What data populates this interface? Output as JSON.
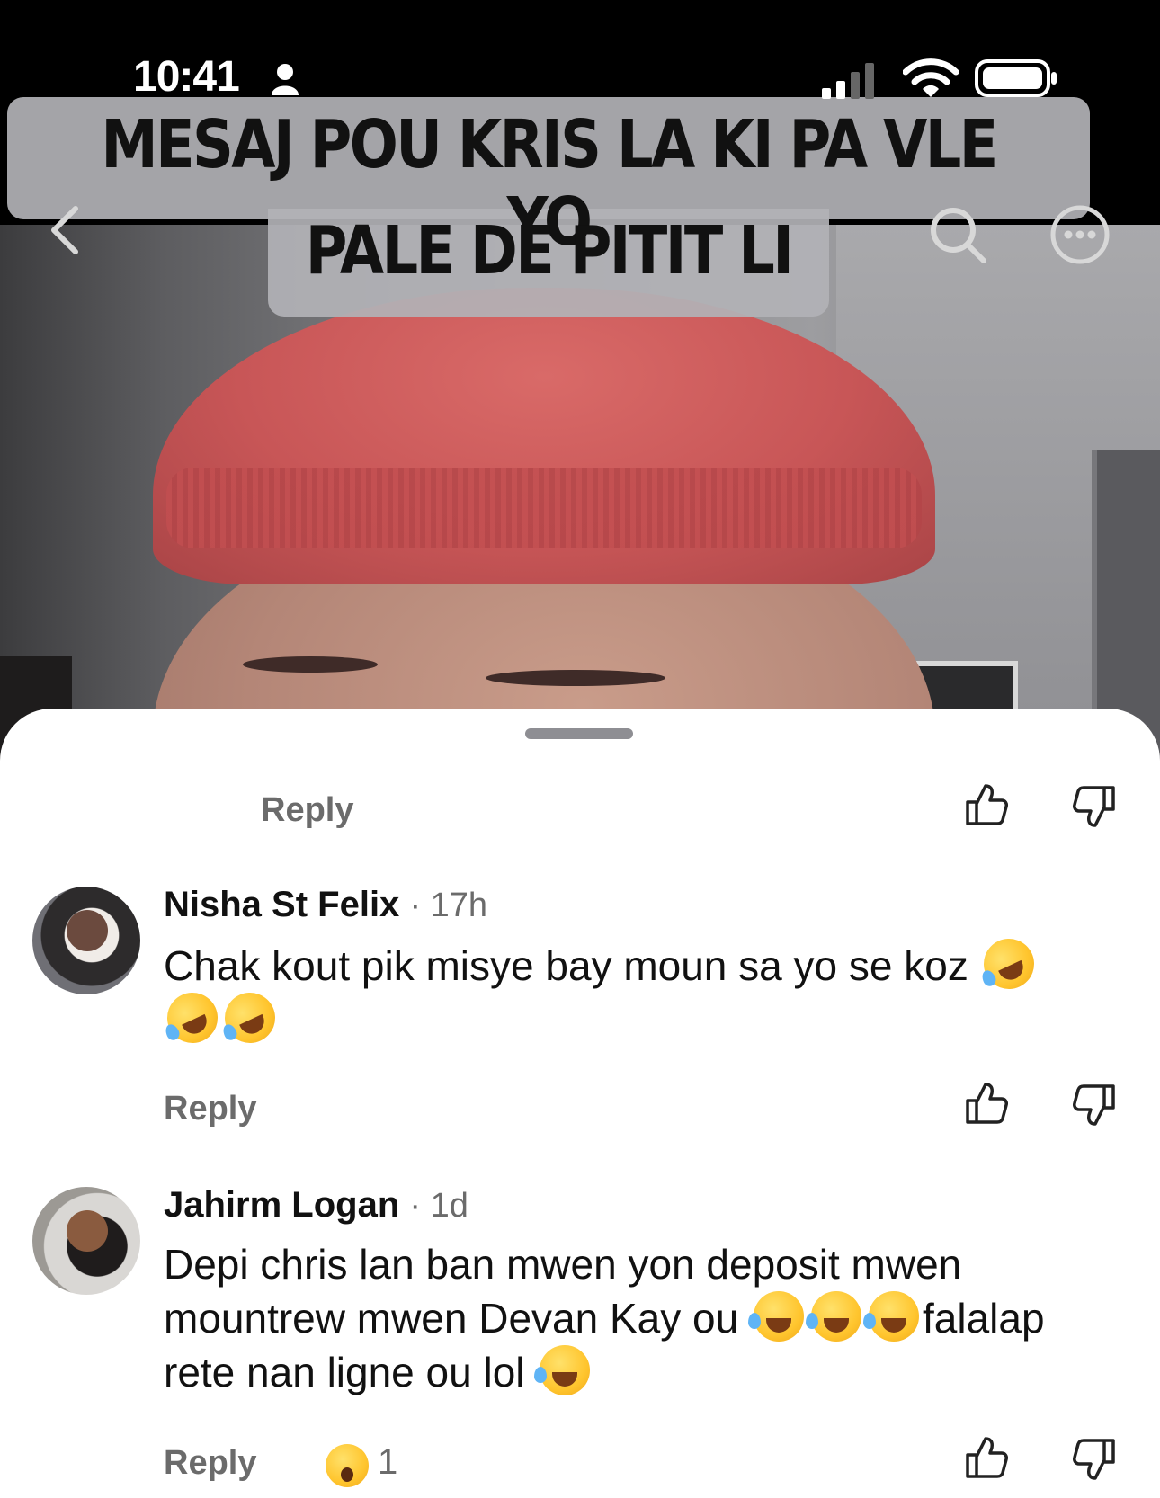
{
  "status_bar": {
    "time": "10:41"
  },
  "video": {
    "caption_line1": "MESAJ POU KRIS LA KI PA VLE YO",
    "caption_line2": "PALE DE PITIT LI"
  },
  "icons": {
    "back": "back-chevron-icon",
    "search": "search-icon",
    "more": "more-icon",
    "like": "thumbs-up-icon",
    "dislike": "thumbs-down-icon"
  },
  "comments": [
    {
      "reply_label": "Reply"
    },
    {
      "author": "Nisha St Felix",
      "meta": "· 17h",
      "text": "Chak kout pik misye bay moun sa yo se koz",
      "reply_label": "Reply"
    },
    {
      "author": "Jahirm Logan",
      "meta": "· 1d",
      "text_line1": "Depi chris lan ban mwen yon deposit mwen",
      "text_line2": "mountrew mwen Devan Kay ou",
      "text_line2_suffix": "falalap",
      "text_line3": "rete nan ligne ou lol",
      "reply_label": "Reply",
      "reaction_count": "1"
    }
  ],
  "colors": {
    "accent_text": "#111111",
    "muted_text": "#6b6b6b",
    "sheet_bg": "#ffffff"
  }
}
